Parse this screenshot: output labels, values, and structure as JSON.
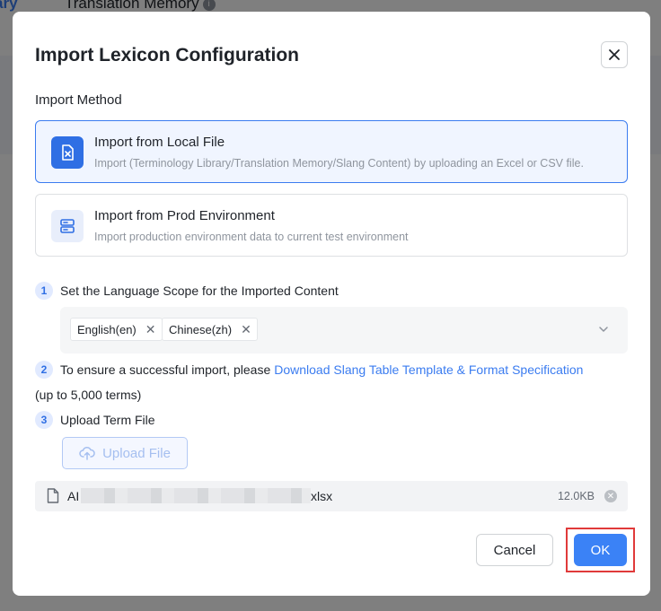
{
  "background": {
    "tab_left": "ary",
    "tab_right": "Translation Memory",
    "tab_info": "i"
  },
  "modal": {
    "title": "Import Lexicon Configuration",
    "close_glyph": "✕",
    "import_method_label": "Import Method",
    "methods": [
      {
        "title": "Import from Local File",
        "description": "Import (Terminology Library/Translation Memory/Slang Content) by uploading an Excel or CSV file.",
        "selected": true,
        "icon": "excel-file-icon"
      },
      {
        "title": "Import from Prod Environment",
        "description": "Import production environment data to current test environment",
        "selected": false,
        "icon": "server-icon"
      }
    ],
    "steps": [
      {
        "num": "1",
        "text": "Set the Language Scope for the Imported Content"
      },
      {
        "num": "2",
        "text": "To ensure a successful import, please",
        "link": "Download Slang Table Template & Format Specification",
        "note": "(up to 5,000 terms)"
      },
      {
        "num": "3",
        "text": "Upload Term File"
      }
    ],
    "languages": [
      {
        "label": "English(en)",
        "remove": "✕"
      },
      {
        "label": "Chinese(zh)",
        "remove": "✕"
      }
    ],
    "upload_button": "Upload File",
    "file": {
      "name_start": "AI",
      "name_end": "xlsx",
      "size": "12.0KB",
      "remove_glyph": "✕"
    },
    "cancel_button": "Cancel",
    "ok_button": "OK"
  },
  "colors": {
    "accent": "#3b7cf0",
    "ok_button": "#3b82f6",
    "highlight_border": "#e03a3a"
  }
}
